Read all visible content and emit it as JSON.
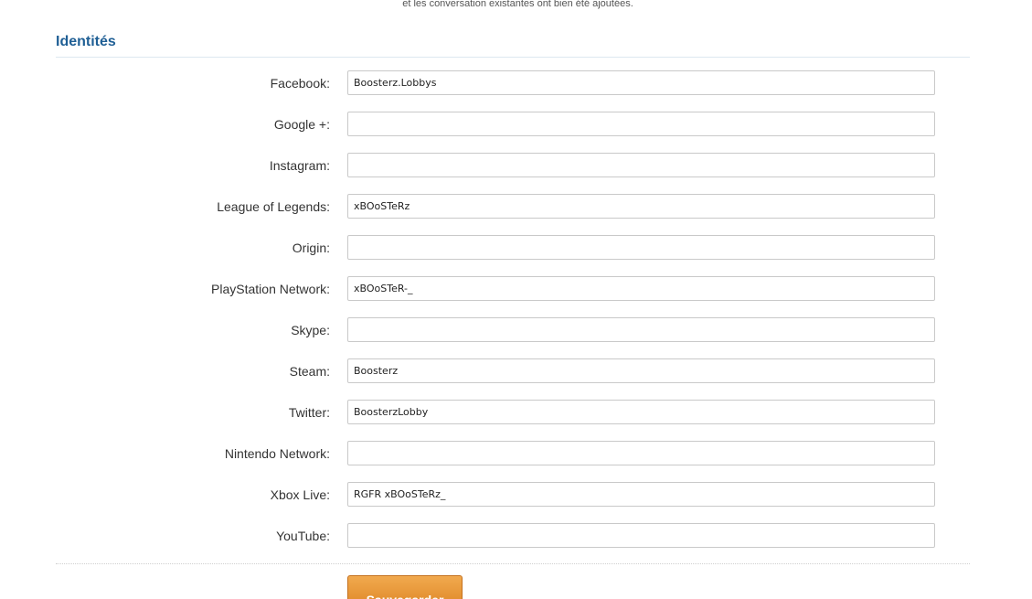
{
  "notice": {
    "text": "et les conversation existantes ont bien été ajoutées."
  },
  "section": {
    "title": "Identités"
  },
  "fields": [
    {
      "label": "Facebook:",
      "value": "Boosterz.Lobbys"
    },
    {
      "label": "Google +:",
      "value": ""
    },
    {
      "label": "Instagram:",
      "value": ""
    },
    {
      "label": "League of Legends:",
      "value": "xBOoSTeRz"
    },
    {
      "label": "Origin:",
      "value": ""
    },
    {
      "label": "PlayStation Network:",
      "value": "xBOoSTeR-_"
    },
    {
      "label": "Skype:",
      "value": ""
    },
    {
      "label": "Steam:",
      "value": "Boosterz"
    },
    {
      "label": "Twitter:",
      "value": "BoosterzLobby"
    },
    {
      "label": "Nintendo Network:",
      "value": ""
    },
    {
      "label": "Xbox Live:",
      "value": "RGFR xBOoSTeRz_"
    },
    {
      "label": "YouTube:",
      "value": ""
    }
  ],
  "actions": {
    "save_label": "Sauvegarder"
  },
  "colors": {
    "section_title": "#1f5f95",
    "button": "#e8952f"
  }
}
